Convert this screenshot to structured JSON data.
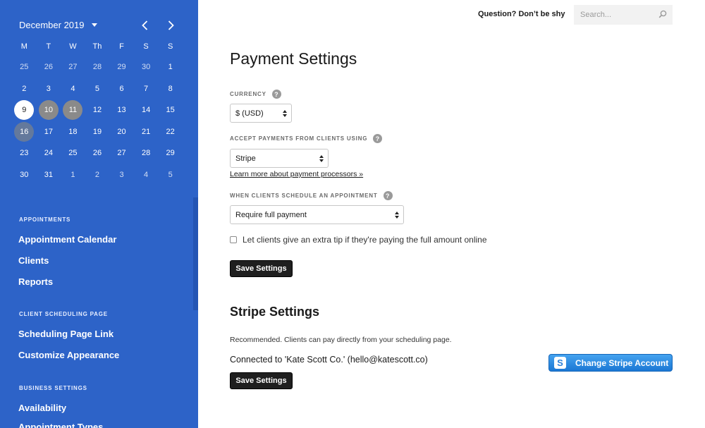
{
  "calendar": {
    "month_label": "December 2019",
    "weekdays": [
      "M",
      "T",
      "W",
      "Th",
      "F",
      "S",
      "S"
    ],
    "weeks": [
      [
        {
          "d": "25",
          "muted": true
        },
        {
          "d": "26",
          "muted": true
        },
        {
          "d": "27",
          "muted": true
        },
        {
          "d": "28",
          "muted": true
        },
        {
          "d": "29",
          "muted": true
        },
        {
          "d": "30",
          "muted": true
        },
        {
          "d": "1"
        }
      ],
      [
        {
          "d": "2"
        },
        {
          "d": "3"
        },
        {
          "d": "4"
        },
        {
          "d": "5"
        },
        {
          "d": "6"
        },
        {
          "d": "7"
        },
        {
          "d": "8"
        }
      ],
      [
        {
          "d": "9",
          "state": "today"
        },
        {
          "d": "10",
          "state": "busy"
        },
        {
          "d": "11",
          "state": "busy"
        },
        {
          "d": "12"
        },
        {
          "d": "13"
        },
        {
          "d": "14"
        },
        {
          "d": "15"
        }
      ],
      [
        {
          "d": "16",
          "state": "partial"
        },
        {
          "d": "17"
        },
        {
          "d": "18"
        },
        {
          "d": "19"
        },
        {
          "d": "20"
        },
        {
          "d": "21"
        },
        {
          "d": "22"
        }
      ],
      [
        {
          "d": "23"
        },
        {
          "d": "24"
        },
        {
          "d": "25"
        },
        {
          "d": "26"
        },
        {
          "d": "27"
        },
        {
          "d": "28"
        },
        {
          "d": "29"
        }
      ],
      [
        {
          "d": "30"
        },
        {
          "d": "31"
        },
        {
          "d": "1",
          "muted": true
        },
        {
          "d": "2",
          "muted": true
        },
        {
          "d": "3",
          "muted": true
        },
        {
          "d": "4",
          "muted": true
        },
        {
          "d": "5",
          "muted": true
        }
      ]
    ]
  },
  "sidebar": {
    "appointments_heading": "APPOINTMENTS",
    "appointments": [
      "Appointment Calendar",
      "Clients",
      "Reports"
    ],
    "scheduling_heading": "CLIENT SCHEDULING PAGE",
    "scheduling": [
      "Scheduling Page Link",
      "Customize Appearance"
    ],
    "business_heading": "BUSINESS SETTINGS",
    "business": [
      "Availability",
      "Appointment Types"
    ]
  },
  "topbar": {
    "question": "Question? Don’t be shy",
    "search_placeholder": "Search..."
  },
  "payment": {
    "title": "Payment Settings",
    "currency_label": "CURRENCY",
    "currency_value": "$ (USD)",
    "accept_label": "ACCEPT PAYMENTS FROM CLIENTS USING",
    "accept_value": "Stripe",
    "learn_more": "Learn more about payment processors »",
    "schedule_label": "WHEN CLIENTS SCHEDULE AN APPOINTMENT",
    "schedule_value": "Require full payment",
    "tip_label": "Let clients give an extra tip if they're paying the full amount online",
    "save_label": "Save Settings"
  },
  "stripe": {
    "title": "Stripe Settings",
    "recommended": "Recommended. Clients can pay directly from your scheduling page.",
    "connected": "Connected to 'Kate Scott Co.' (hello@katescott.co)",
    "change_label": "Change Stripe Account",
    "save_label": "Save Settings"
  },
  "colors": {
    "sidebar": "#2d63c8",
    "stripe_button": "#1b77d4",
    "dark_button": "#1f1f1f"
  }
}
